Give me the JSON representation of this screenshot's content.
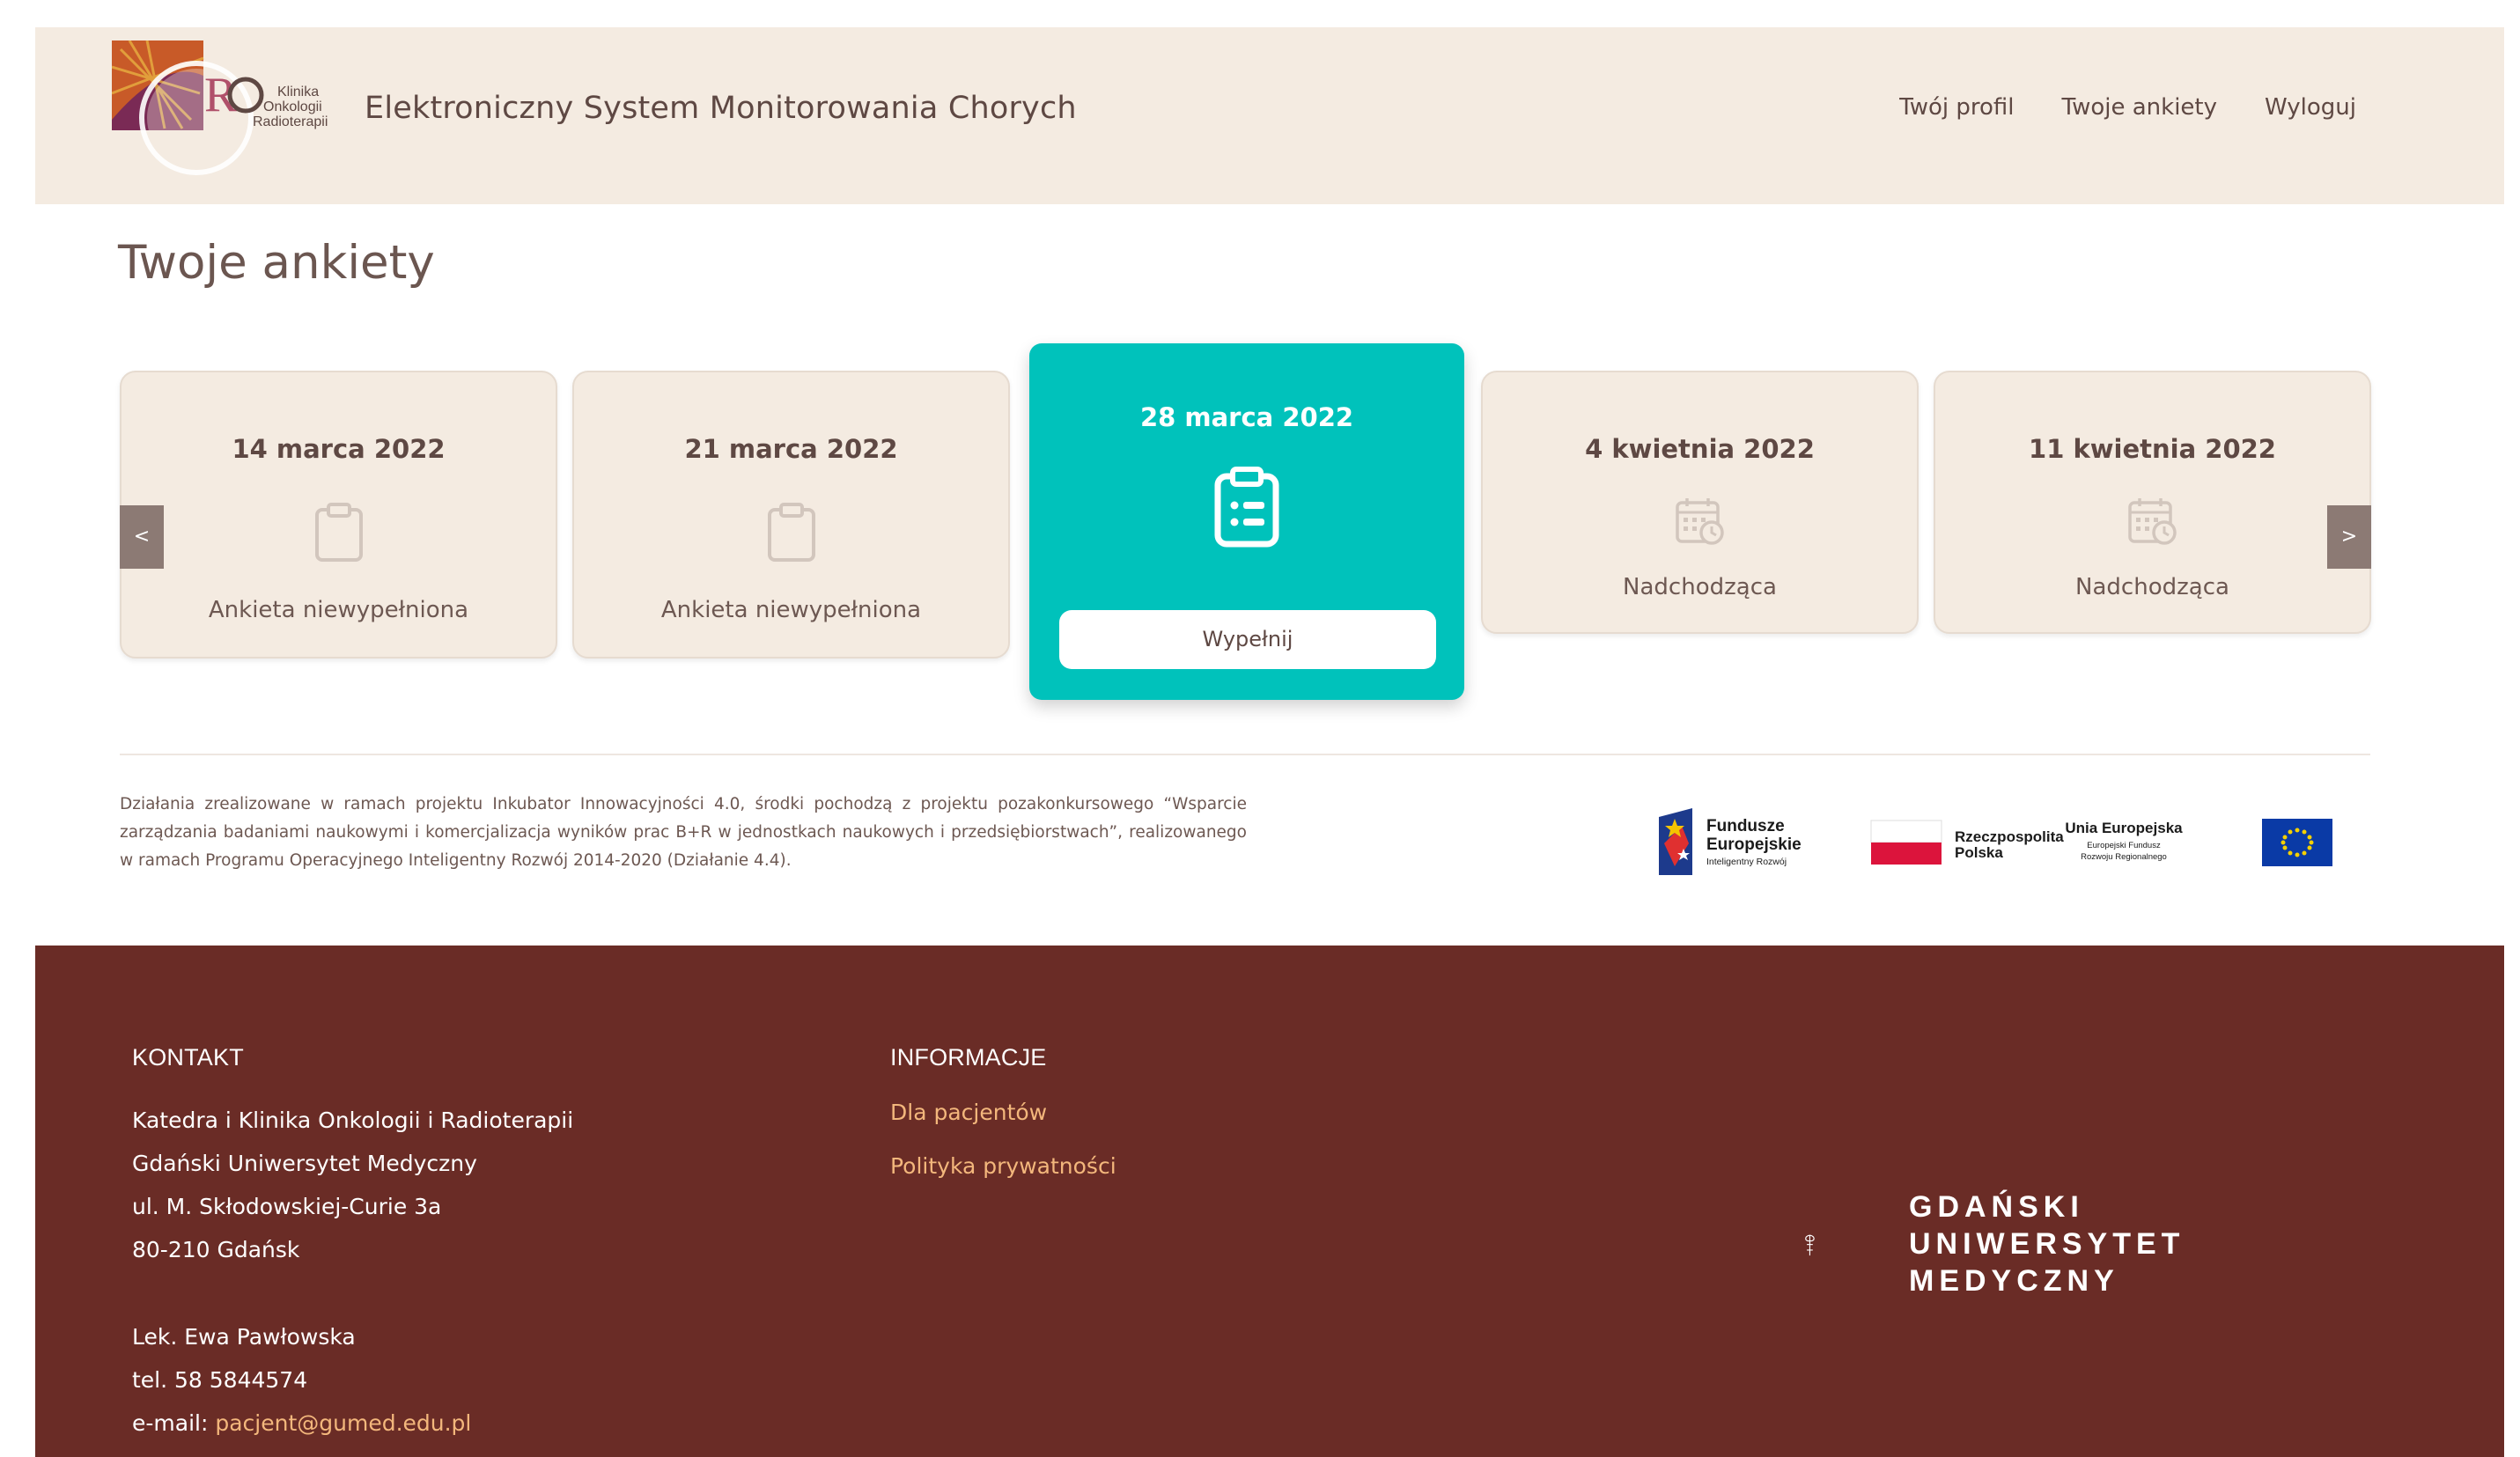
{
  "header": {
    "logo_text": [
      "Klinika",
      "Onkologii",
      "Radioterapii"
    ],
    "app_title": "Elektroniczny System Monitorowania Chorych",
    "nav": [
      "Twój profil",
      "Twoje ankiety",
      "Wyloguj"
    ]
  },
  "page_title": "Twoje ankiety",
  "carousel": {
    "prev": "<",
    "next": ">",
    "cards": [
      {
        "date": "14 marca 2022",
        "status": "Ankieta niewypełniona",
        "icon": "clipboard-empty-icon"
      },
      {
        "date": "21 marca 2022",
        "status": "Ankieta niewypełniona",
        "icon": "clipboard-empty-icon"
      },
      {
        "date": "28 marca 2022",
        "button": "Wypełnij",
        "icon": "clipboard-list-icon"
      },
      {
        "date": "4 kwietnia 2022",
        "status": "Nadchodząca",
        "icon": "calendar-clock-icon"
      },
      {
        "date": "11 kwietnia 2022",
        "status": "Nadchodząca",
        "icon": "calendar-clock-icon"
      }
    ]
  },
  "funding_text": "Działania zrealizowane w ramach projektu Inkubator Innowacyjności 4.0, środki pochodzą z projektu pozakonkursowego “Wsparcie zarządzania badaniami naukowymi i komercjalizacja wyników prac B+R w jednostkach naukowych i przedsiębiorstwach”, realizowanego w ramach Programu Operacyjnego Inteligentny Rozwój 2014-2020 (Działanie 4.4).",
  "eu_logos": {
    "fe_title1": "Fundusze",
    "fe_title2": "Europejskie",
    "fe_sub": "Inteligentny Rozwój",
    "rp1": "Rzeczpospolita",
    "rp2": "Polska",
    "ue_title": "Unia Europejska",
    "ue_sub1": "Europejski Fundusz",
    "ue_sub2": "Rozwoju Regionalnego"
  },
  "footer": {
    "kontakt_heading": "KONTAKT",
    "kontakt_lines": [
      "Katedra i Klinika Onkologii i Radioterapii",
      "Gdański Uniwersytet Medyczny",
      "ul. M. Skłodowskiej-Curie 3a",
      "80-210 Gdańsk"
    ],
    "person": "Lek. Ewa Pawłowska",
    "phone": "tel. 58 5844574",
    "email_label": "e-mail: ",
    "email": "pacjent@gumed.edu.pl",
    "info_heading": "INFORMACJE",
    "info_links": [
      "Dla pacjentów",
      "Polityka prywatności"
    ],
    "university": [
      "GDAŃSKI",
      "UNIWERSYTET",
      "MEDYCZNY"
    ]
  },
  "colors": {
    "header_bg": "#f4ebe1",
    "active_card": "#00c2bb",
    "footer_bg": "#6a2c26",
    "footer_link": "#f3b77c"
  }
}
